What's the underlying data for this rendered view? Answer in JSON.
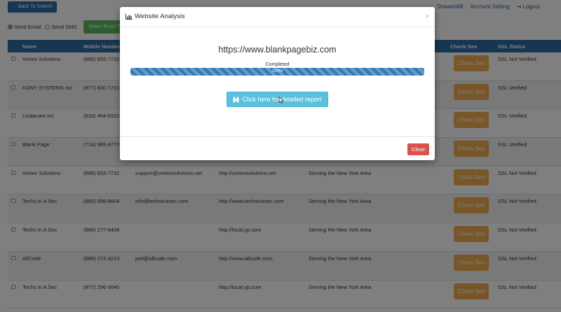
{
  "topbar": {
    "back_label": "Back To Search",
    "username": "Shawon88",
    "account_label": "Account Setting",
    "logout_label": "Logout"
  },
  "options": {
    "send_email": "Send Email",
    "send_sms": "Send SMS",
    "select_email_label": "Select Email Tem"
  },
  "table": {
    "headers": {
      "name": "Name",
      "mobile": "Mobile Number",
      "check_seo": "Check Seo",
      "ssl": "SSL Status"
    },
    "seo_button_label": "Check Seo",
    "rows": [
      {
        "name": "Vortex Solutions",
        "mobile": "(888) 833-7732",
        "email": "",
        "website": "",
        "area": "",
        "ssl": "SSL Not Verified"
      },
      {
        "name": "KONY SYSTEMS Inc",
        "mobile": "(877) 830-7701",
        "email": "",
        "website": "",
        "area": "",
        "ssl": "SSL Verified"
      },
      {
        "name": "Lindacare Inc",
        "mobile": "(833) 464-6322",
        "email": "",
        "website": "",
        "area": "",
        "ssl": "SSL Verified"
      },
      {
        "name": "Blank Page",
        "mobile": "(716) 989-4777",
        "email": "",
        "website": "",
        "area": "",
        "ssl": "SSL Verified"
      },
      {
        "name": "Vortex Solutions",
        "mobile": "(888) 833-7732",
        "email": "support@vortexsolutions.net",
        "website": "http://vortexsolutions.net",
        "area": "Serving the New York Area",
        "ssl": "SSL Not Verified"
      },
      {
        "name": "Techs In A Sec",
        "mobile": "(866) 698-8604",
        "email": "info@techsinasec.com",
        "website": "http://www.techsinasec.com",
        "area": "Serving the New York Area",
        "ssl": "SSL Not Verified"
      },
      {
        "name": "Techs In A Sec",
        "mobile": "(888) 277-8408",
        "email": "",
        "website": "http://local.yp.com",
        "area": "Serving the New York Area",
        "ssl": "SSL Not Verified"
      },
      {
        "name": "AllCode",
        "mobile": "(888) 272-4213",
        "email": "joel@allcode.com",
        "website": "http://www.allcode.com",
        "area": "Serving the New York Area",
        "ssl": "SSL Not Verified"
      },
      {
        "name": "Techs In A Sec",
        "mobile": "(877) 296-3040",
        "email": "",
        "website": "http://local.yp.com",
        "area": "Serving the New York Area",
        "ssl": "SSL Not Verified"
      }
    ]
  },
  "modal": {
    "title": "Website Analysis",
    "close_x": "×",
    "url": "https://www.blankpagebiz.com",
    "status": "Completed",
    "progress_percent": 100,
    "progress_label": "100%",
    "report_label": "Click here for detailed report",
    "close_label": "Close"
  },
  "icons": {
    "title_icon": "bar-chart-icon",
    "report_icon": "binoculars-icon",
    "back_icon": "arrow-left-icon",
    "logout_icon": "logout-icon"
  },
  "colors": {
    "primary": "#2e6da4",
    "success": "#5cb85c",
    "warning": "#f0ad4e",
    "info": "#5bc0de",
    "danger": "#d9534f"
  }
}
